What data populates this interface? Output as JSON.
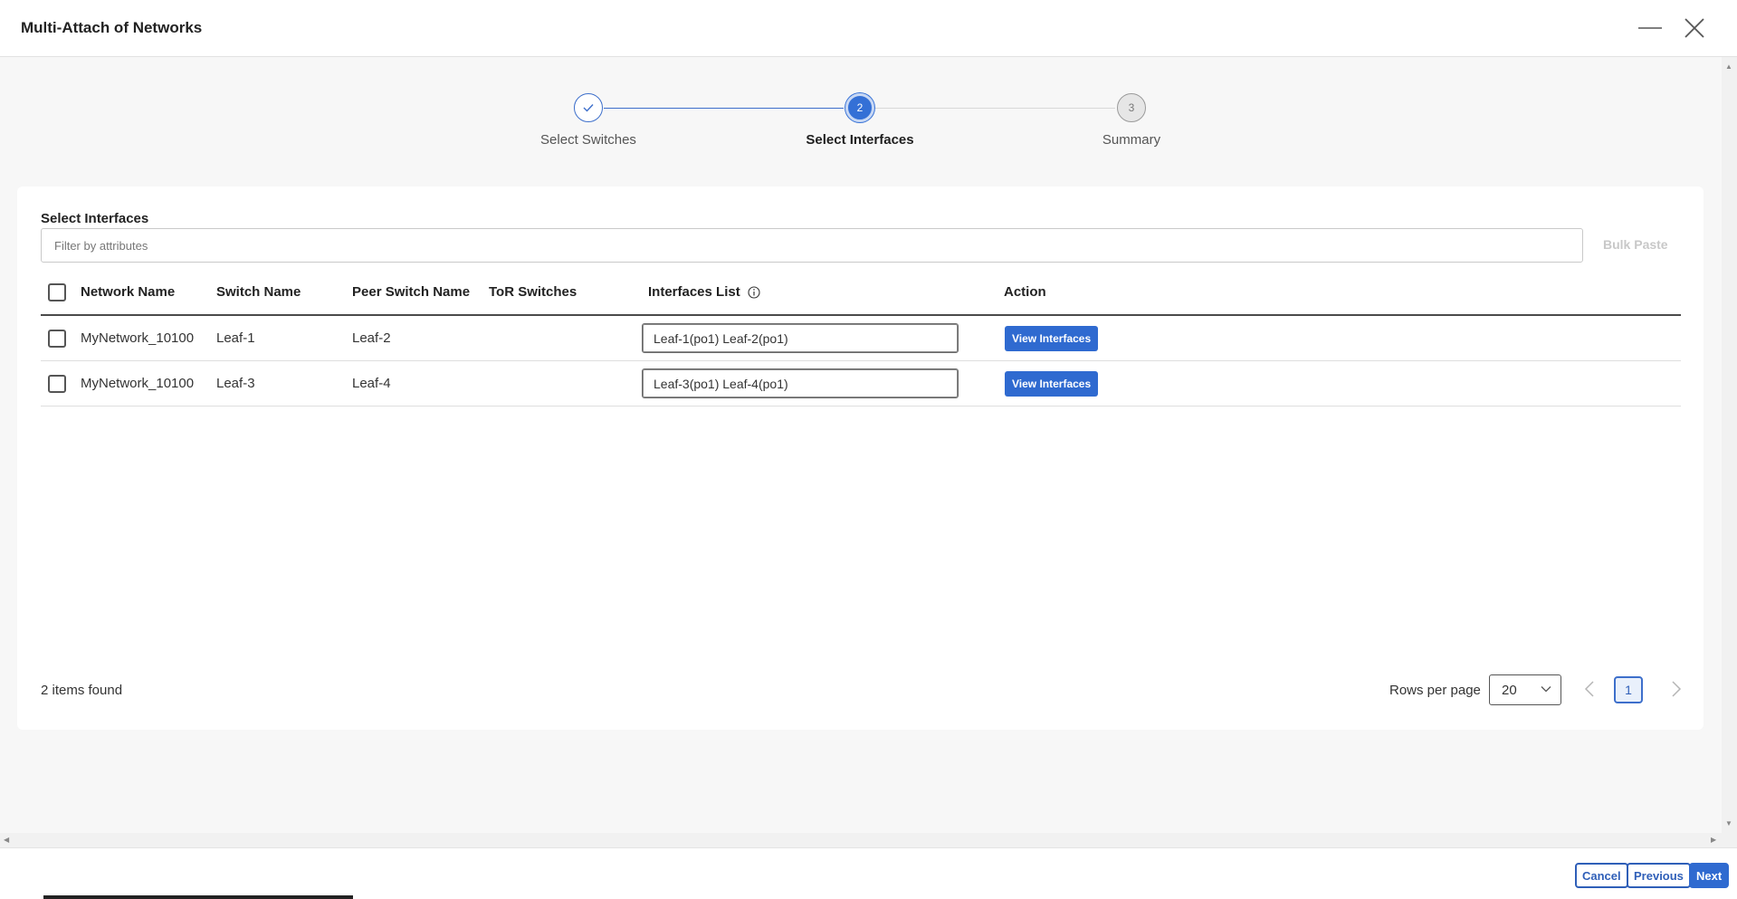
{
  "window": {
    "title": "Multi-Attach of Networks",
    "minimize_icon": "minimize-icon",
    "close_icon": "close-icon"
  },
  "stepper": {
    "steps": [
      {
        "number": "1",
        "label": "Select Switches",
        "state": "done",
        "icon": "check-icon"
      },
      {
        "number": "2",
        "label": "Select Interfaces",
        "state": "active"
      },
      {
        "number": "3",
        "label": "Summary",
        "state": "pending"
      }
    ]
  },
  "section": {
    "title": "Select Interfaces",
    "filter_placeholder": "Filter by attributes",
    "bulk_paste_label": "Bulk Paste"
  },
  "table": {
    "headers": {
      "network_name": "Network Name",
      "switch_name": "Switch Name",
      "peer_switch_name": "Peer Switch Name",
      "tor_switches": "ToR Switches",
      "interfaces_list": "Interfaces List",
      "action": "Action"
    },
    "rows": [
      {
        "network_name": "MyNetwork_10100",
        "switch_name": "Leaf-1",
        "peer_switch_name": "Leaf-2",
        "tor_switches": "",
        "interfaces_list": "Leaf-1(po1) Leaf-2(po1)",
        "action_label": "View Interfaces"
      },
      {
        "network_name": "MyNetwork_10100",
        "switch_name": "Leaf-3",
        "peer_switch_name": "Leaf-4",
        "tor_switches": "",
        "interfaces_list": "Leaf-3(po1) Leaf-4(po1)",
        "action_label": "View Interfaces"
      }
    ]
  },
  "pagination": {
    "items_found": "2 items found",
    "rows_per_page_label": "Rows per page",
    "rows_per_page_value": "20",
    "current_page": "1"
  },
  "footer": {
    "cancel_label": "Cancel",
    "previous_label": "Previous",
    "next_label": "Next"
  },
  "colors": {
    "accent": "#2f6ad0",
    "stepper_done": "#3d6fcb",
    "stepper_pending": "#d9d9d9"
  }
}
